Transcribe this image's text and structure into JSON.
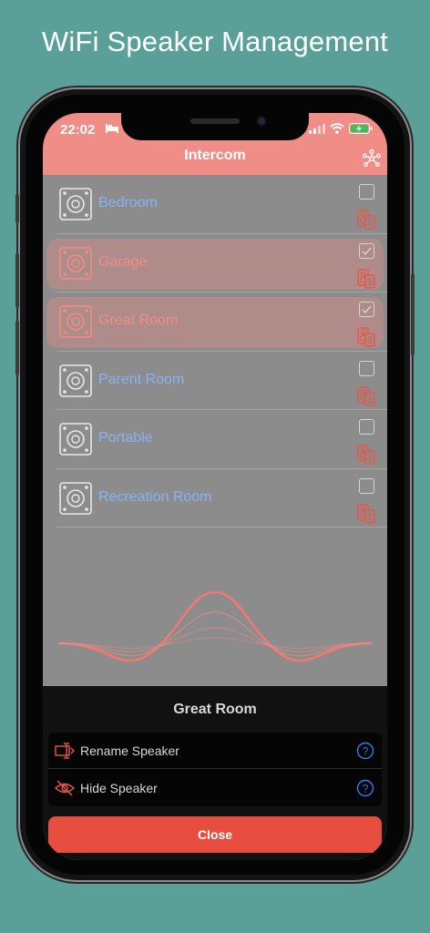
{
  "headline": "WiFi Speaker Management",
  "status_bar": {
    "time": "22:02"
  },
  "nav": {
    "title": "Intercom"
  },
  "speakers": [
    {
      "name": "Bedroom",
      "checked": false,
      "selected": false
    },
    {
      "name": "Garage",
      "checked": true,
      "selected": true
    },
    {
      "name": "Great Room",
      "checked": true,
      "selected": true
    },
    {
      "name": "Parent Room",
      "checked": false,
      "selected": false
    },
    {
      "name": "Portable",
      "checked": false,
      "selected": false
    },
    {
      "name": "Recreation Room",
      "checked": false,
      "selected": false
    }
  ],
  "sheet": {
    "title": "Great Room",
    "menu": [
      {
        "label": "Rename Speaker",
        "icon": "rename-icon"
      },
      {
        "label": "Hide Speaker",
        "icon": "eye-slash-icon"
      }
    ],
    "close_label": "Close"
  },
  "colors": {
    "background": "#5a9f98",
    "header": "#f08d86",
    "speaker_name": "#86b3f5",
    "selected_name": "#f08d86",
    "close_button": "#e84e3f",
    "accent_icon": "#e8574a",
    "help_icon": "#2f7ef0"
  }
}
